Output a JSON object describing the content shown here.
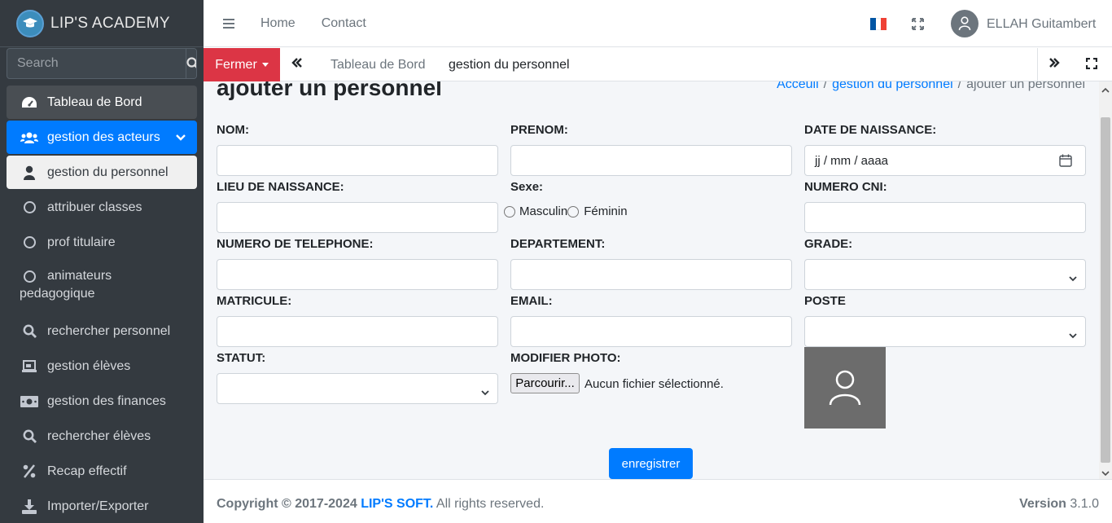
{
  "brand": {
    "name": "LIP'S ACADEMY"
  },
  "sidebar": {
    "search_placeholder": "Search",
    "items": [
      {
        "label": "Tableau de Bord",
        "icon": "tachometer-icon"
      },
      {
        "label": "gestion des acteurs",
        "icon": "users-icon"
      },
      {
        "label": "gestion du personnel",
        "icon": "user-icon"
      },
      {
        "label": "attribuer classes",
        "icon": "circle-icon"
      },
      {
        "label": "prof titulaire",
        "icon": "circle-icon"
      },
      {
        "label_line1": "animateurs",
        "label_line2": "pedagogique",
        "icon": "circle-icon"
      },
      {
        "label": "rechercher personnel",
        "icon": "search-icon"
      },
      {
        "label": "gestion élèves",
        "icon": "chalkboard-icon"
      },
      {
        "label": "gestion des finances",
        "icon": "money-icon"
      },
      {
        "label": "rechercher élèves",
        "icon": "search-icon"
      },
      {
        "label": "Recap effectif",
        "icon": "percent-icon"
      },
      {
        "label": "Importer/Exporter",
        "icon": "download-icon"
      }
    ]
  },
  "topbar": {
    "links": [
      "Home",
      "Contact"
    ],
    "user_name": "ELLAH Guitambert"
  },
  "tabbar": {
    "close_label": "Fermer",
    "tabs": [
      "Tableau de Bord",
      "gestion du personnel"
    ]
  },
  "page": {
    "title": "ajouter un personnel",
    "breadcrumb": [
      "Acceuil",
      "gestion du personnel",
      "ajouter un personnel"
    ]
  },
  "form": {
    "nom": "NOM:",
    "prenom": "PRENOM:",
    "date_naissance": "DATE DE NAISSANCE:",
    "date_placeholder": "jj / mm / aaaa",
    "lieu_naissance": "LIEU DE NAISSANCE:",
    "sexe": "Sexe:",
    "masculin": "Masculin",
    "feminin": "Féminin",
    "numero_cni": "NUMERO CNI:",
    "telephone": "NUMERO DE TELEPHONE:",
    "departement": "DEPARTEMENT:",
    "grade": "GRADE:",
    "matricule": "MATRICULE:",
    "email": "EMAIL:",
    "poste": "POSTE",
    "statut": "STATUT:",
    "modifier_photo": "MODIFIER PHOTO:",
    "browse_label": "Parcourir...",
    "no_file": "Aucun fichier sélectionné.",
    "save_label": "enregistrer"
  },
  "footer": {
    "copyright_prefix": "Copyright © 2017-2024",
    "company": "LIP'S SOFT.",
    "rights": "All rights reserved.",
    "version_label": "Version",
    "version": "3.1.0"
  },
  "colors": {
    "sidebar_bg": "#343a40",
    "primary": "#007bff",
    "danger": "#dc3545",
    "content_bg": "#f4f6f9"
  }
}
